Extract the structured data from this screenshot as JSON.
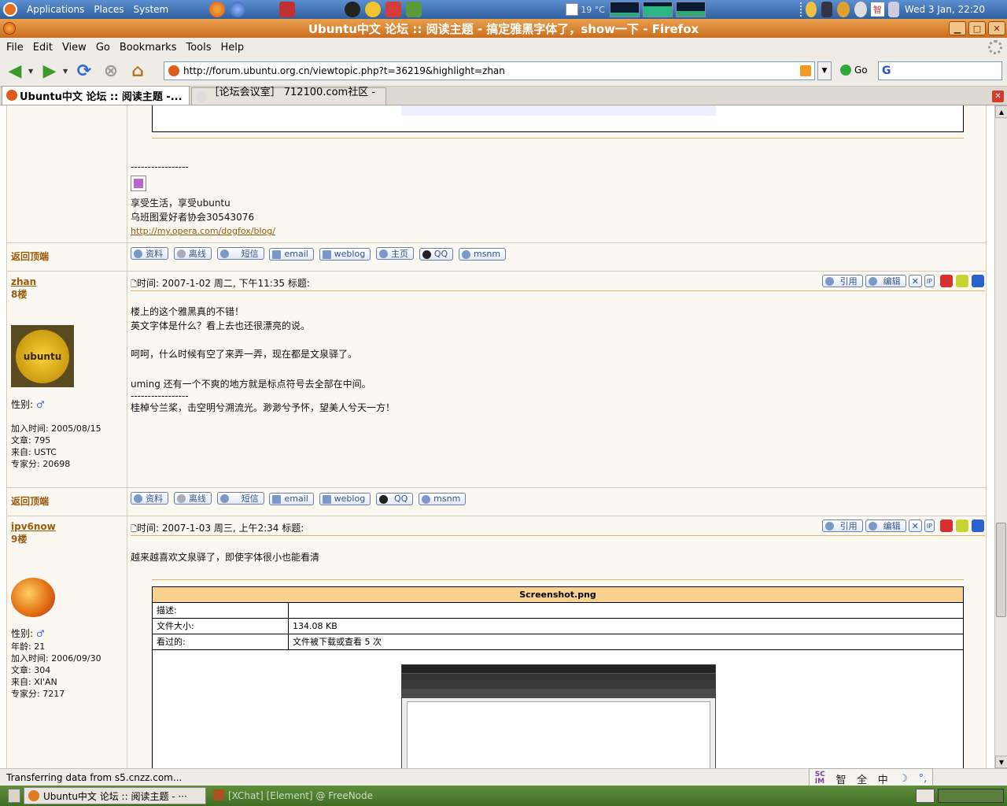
{
  "top_panel": {
    "menus": [
      "Applications",
      "Places",
      "System"
    ],
    "weather": "19 °C",
    "clock": "Wed  3 Jan, 22:20",
    "ime_indicator": "智"
  },
  "window": {
    "title": "Ubuntu中文 论坛 :: 阅读主题 - 搞定雅黑字体了，show一下 - Firefox",
    "buttons": [
      "minimize",
      "maximize",
      "close"
    ]
  },
  "menubar": [
    "File",
    "Edit",
    "View",
    "Go",
    "Bookmarks",
    "Tools",
    "Help"
  ],
  "nav": {
    "url": "http://forum.ubuntu.org.cn/viewtopic.php?t=36219&highlight=zhan",
    "go_label": "Go",
    "search_value": ""
  },
  "tabs": [
    {
      "label": "Ubuntu中文 论坛 :: 阅读主题 -...",
      "active": true
    },
    {
      "label": "［论坛会议室］ 712100.com社区 - ...",
      "active": false
    }
  ],
  "prev_post": {
    "sig_dashes": "-----------------",
    "sig_line1": "享受生活，享受ubuntu",
    "sig_line2": "乌班图爱好者协会30543076",
    "sig_link": "http://my.opera.com/dogfox/blog/",
    "back_to_top": "返回顶端",
    "buttons": [
      "资料",
      "离线",
      "短信",
      "email",
      "weblog",
      "主页",
      "QQ",
      "msnm"
    ]
  },
  "post8": {
    "author": "zhan",
    "floor": "8楼",
    "avatar_text": "ubuntu",
    "gender_label": "性别:",
    "gender_icon": "male-symbol-icon",
    "joined": "加入时间: 2005/08/15",
    "posts": "文章: 795",
    "from": "来自: USTC",
    "score": "专家分: 20698",
    "meta": "时间: 2007-1-02 周二, 下午11:35    标题:",
    "action_quote": "引用",
    "action_edit": "编辑",
    "body": [
      "楼上的这个雅黑真的不错！",
      "英文字体是什么？看上去也还很漂亮的说。",
      "",
      "呵呵，什么时候有空了来弄一弄，现在都是文泉驿了。",
      "",
      "uming 还有一个不爽的地方就是标点符号去全部在中间。"
    ],
    "sig_dashes": "-----------------",
    "sig": "桂棹兮兰桨，击空明兮溯流光。渺渺兮予怀，望美人兮天一方！",
    "back_to_top": "返回顶端",
    "buttons": [
      "资料",
      "离线",
      "短信",
      "email",
      "weblog",
      "QQ",
      "msnm"
    ]
  },
  "post9": {
    "author": "ipv6now",
    "floor": "9楼",
    "gender_label": "性别:",
    "age": "年龄: 21",
    "joined": "加入时间: 2006/09/30",
    "posts": "文章: 304",
    "from": "来自: XI'AN",
    "score": "专家分: 7217",
    "meta": "时间: 2007-1-03 周三, 上午2:34    标题:",
    "action_quote": "引用",
    "action_edit": "编辑",
    "body": "越来越喜欢文泉驿了，即使字体很小也能看清",
    "attachment": {
      "filename": "Screenshot.png",
      "desc_label": "描述:",
      "desc_value": "",
      "size_label": "文件大小:",
      "size_value": "134.08 KB",
      "views_label": "看过的:",
      "views_value": "文件被下载或查看 5 次"
    }
  },
  "status": {
    "text": "Transferring data from s5.cnzz.com..."
  },
  "ime": {
    "items": [
      "智",
      "全",
      "中",
      "☽",
      "°,"
    ]
  },
  "taskbar": {
    "active": "Ubuntu中文 论坛 :: 阅读主题 - ···",
    "other": "[XChat] [Element] @ FreeNode"
  },
  "colors": {
    "accent_orange": "#c96e1f",
    "forum_link": "#9a5a0a",
    "attachment_header": "#f9d38e"
  }
}
